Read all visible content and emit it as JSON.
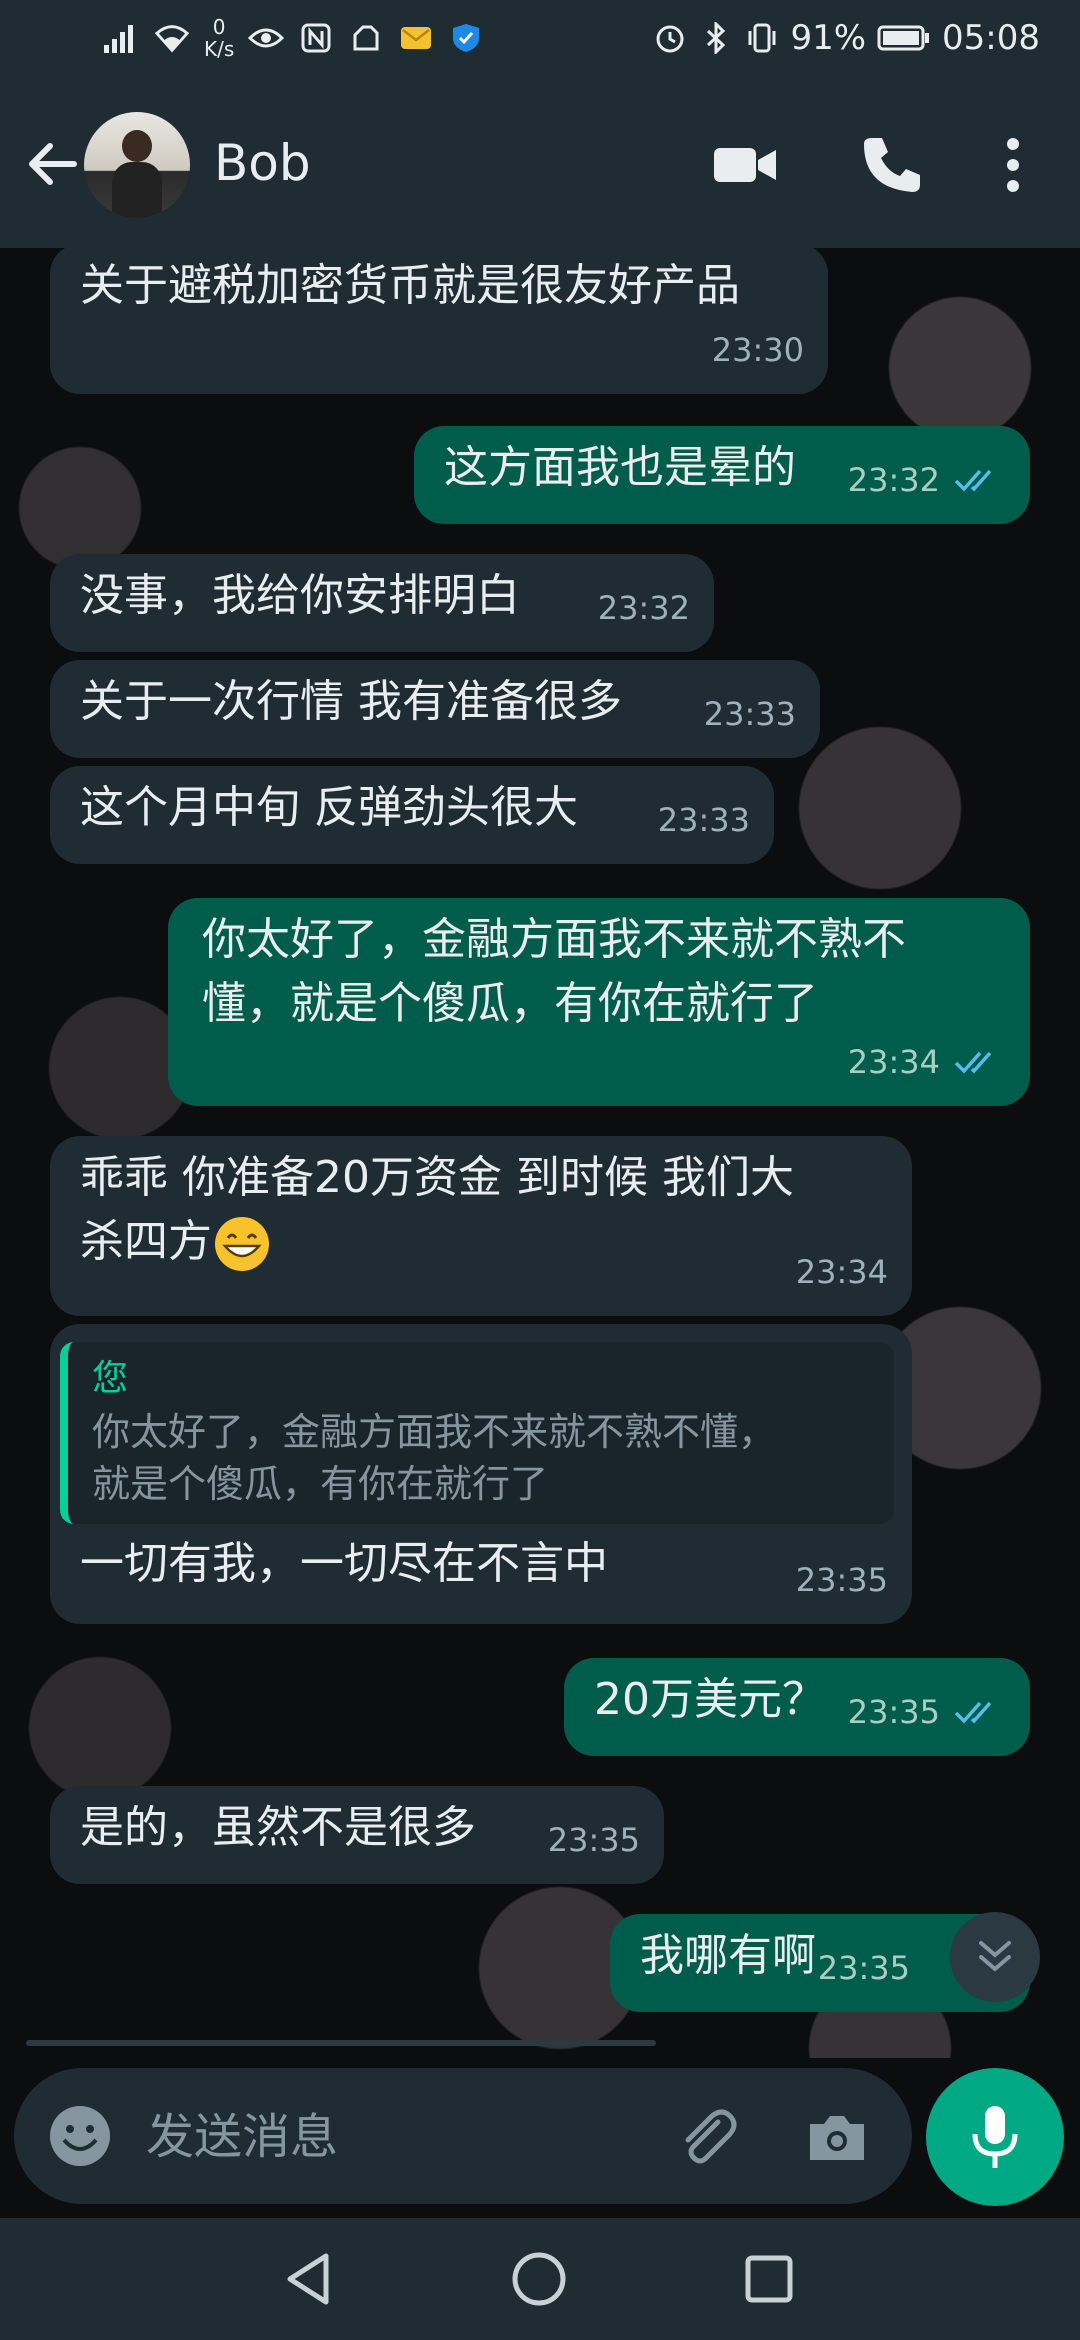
{
  "status_bar": {
    "net_speed_value": "0",
    "net_speed_unit": "K/s",
    "battery": "91%",
    "time": "05:08"
  },
  "header": {
    "contact_name": "Bob"
  },
  "messages": [
    {
      "dir": "in",
      "text": "关于避税加密货币就是很友好产品",
      "time": "23:30"
    },
    {
      "dir": "out",
      "text": "这方面我也是晕的",
      "time": "23:32"
    },
    {
      "dir": "in",
      "text": "没事，我给你安排明白",
      "time": "23:32"
    },
    {
      "dir": "in",
      "text": "关于一次行情 我有准备很多",
      "time": "23:33"
    },
    {
      "dir": "in",
      "text": "这个月中旬 反弹劲头很大",
      "time": "23:33"
    },
    {
      "dir": "out",
      "text": "你太好了，金融方面我不来就不熟不\n懂，就是个傻瓜，有你在就行了",
      "time": "23:34"
    },
    {
      "dir": "in",
      "text": "乖乖 你准备20万资金 到时候 我们大\n杀四方",
      "time": "23:34"
    },
    {
      "dir": "in",
      "quote_author": "您",
      "quote_text": "你太好了，金融方面我不来就不熟不懂，\n就是个傻瓜，有你在就行了",
      "text": "一切有我，一切尽在不言中",
      "time": "23:35"
    },
    {
      "dir": "out",
      "text": "20万美元？",
      "time": "23:35"
    },
    {
      "dir": "in",
      "text": "是的，虽然不是很多",
      "time": "23:35"
    },
    {
      "dir": "out",
      "text": "我哪有啊",
      "time": "23:35"
    }
  ],
  "input": {
    "placeholder": "发送消息"
  },
  "colors": {
    "incoming_bubble": "#1f2c34",
    "outgoing_bubble": "#005c4b",
    "accent": "#00a884",
    "read_ticks": "#53bdeb"
  }
}
